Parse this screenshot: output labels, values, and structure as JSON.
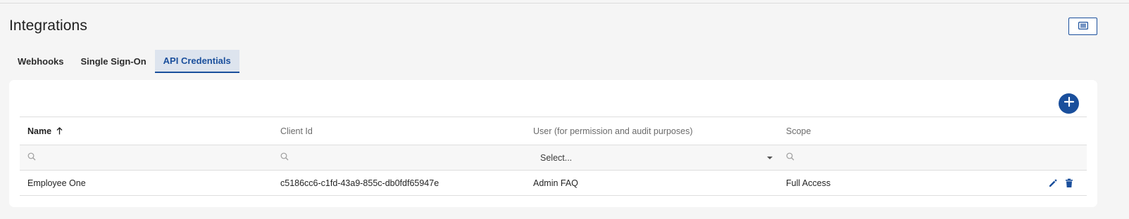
{
  "page": {
    "title": "Integrations"
  },
  "tabs": [
    {
      "label": "Webhooks",
      "active": false
    },
    {
      "label": "Single Sign-On",
      "active": false
    },
    {
      "label": "API Credentials",
      "active": true
    }
  ],
  "table": {
    "columns": [
      {
        "label": "Name",
        "sorted": "ascending"
      },
      {
        "label": "Client Id"
      },
      {
        "label": "User (for permission and audit purposes)"
      },
      {
        "label": "Scope"
      }
    ],
    "filters": {
      "user_select_placeholder": "Select..."
    },
    "rows": [
      {
        "name": "Employee One",
        "client_id": "c5186cc6-c1fd-43a9-855c-db0fdf65947e",
        "user": "Admin FAQ",
        "scope": "Full Access"
      }
    ]
  },
  "icons": {
    "view_toggle": "list-view-icon",
    "add": "plus-icon",
    "sort": "arrow-up-icon",
    "filter": "search-icon",
    "edit": "pencil-icon",
    "delete": "trash-icon"
  },
  "colors": {
    "accent": "#1a4f9c",
    "active_tab_bg": "#dde4ee",
    "background": "#f5f5f5"
  }
}
